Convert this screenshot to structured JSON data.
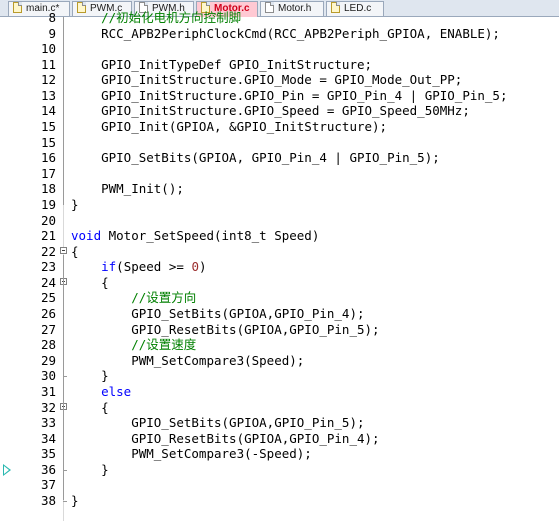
{
  "tabs": [
    {
      "label": "main.c*",
      "active": false,
      "modified": true
    },
    {
      "label": "PWM.c",
      "active": false
    },
    {
      "label": "PWM.h",
      "active": false
    },
    {
      "label": "Motor.c",
      "active": true
    },
    {
      "label": "Motor.h",
      "active": false
    },
    {
      "label": "LED.c",
      "active": false
    }
  ],
  "colors": {
    "keyword": "#0000ff",
    "number": "#9b2c2c",
    "comment": "#008000",
    "active_tab": "#ffc9d3",
    "execution_marker": "#2ab8b0"
  },
  "lines": [
    {
      "num": "8",
      "code": "    //初始化电机方向控制脚"
    },
    {
      "num": "9",
      "code": "    RCC_APB2PeriphClockCmd(RCC_APB2Periph_GPIOA, ENABLE);"
    },
    {
      "num": "10",
      "code": ""
    },
    {
      "num": "11",
      "code": "    GPIO_InitTypeDef GPIO_InitStructure;"
    },
    {
      "num": "12",
      "code": "    GPIO_InitStructure.GPIO_Mode = GPIO_Mode_Out_PP;"
    },
    {
      "num": "13",
      "code": "    GPIO_InitStructure.GPIO_Pin = GPIO_Pin_4 | GPIO_Pin_5;"
    },
    {
      "num": "14",
      "code": "    GPIO_InitStructure.GPIO_Speed = GPIO_Speed_50MHz;"
    },
    {
      "num": "15",
      "code": "    GPIO_Init(GPIOA, &GPIO_InitStructure);"
    },
    {
      "num": "15",
      "code": ""
    },
    {
      "num": "16",
      "code": "    GPIO_SetBits(GPIOA, GPIO_Pin_4 | GPIO_Pin_5);"
    },
    {
      "num": "17",
      "code": ""
    },
    {
      "num": "18",
      "code": "    PWM_Init();"
    },
    {
      "num": "19",
      "code": "}"
    },
    {
      "num": "20",
      "code": ""
    },
    {
      "num": "21",
      "code": "void Motor_SetSpeed(int8_t Speed)"
    },
    {
      "num": "22",
      "code": "{"
    },
    {
      "num": "23",
      "code": "    if(Speed >= 0)"
    },
    {
      "num": "24",
      "code": "    {"
    },
    {
      "num": "25",
      "code": "        //设置方向"
    },
    {
      "num": "26",
      "code": "        GPIO_SetBits(GPIOA,GPIO_Pin_4);"
    },
    {
      "num": "27",
      "code": "        GPIO_ResetBits(GPIOA,GPIO_Pin_5);"
    },
    {
      "num": "28",
      "code": "        //设置速度"
    },
    {
      "num": "29",
      "code": "        PWM_SetCompare3(Speed);"
    },
    {
      "num": "30",
      "code": "    }"
    },
    {
      "num": "31",
      "code": "    else"
    },
    {
      "num": "32",
      "code": "    {"
    },
    {
      "num": "33",
      "code": "        GPIO_SetBits(GPIOA,GPIO_Pin_5);"
    },
    {
      "num": "34",
      "code": "        GPIO_ResetBits(GPIOA,GPIO_Pin_4);"
    },
    {
      "num": "35",
      "code": "        PWM_SetCompare3(-Speed);"
    },
    {
      "num": "36",
      "code": "    }"
    },
    {
      "num": "37",
      "code": ""
    },
    {
      "num": "38",
      "code": "}"
    }
  ],
  "fold_markers": [
    "22",
    "24",
    "32"
  ],
  "execution_marker_line": "36"
}
